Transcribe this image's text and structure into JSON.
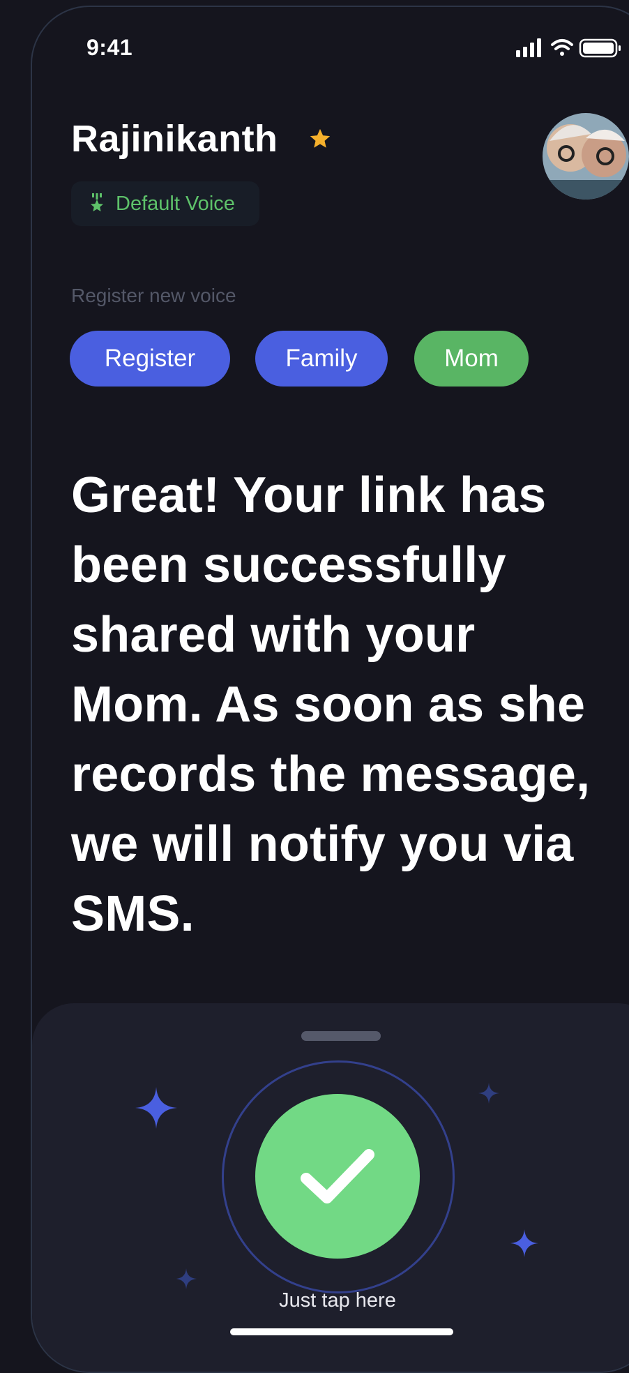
{
  "status_bar": {
    "time": "9:41"
  },
  "header": {
    "name": "Rajinikanth",
    "voice_badge": "Default Voice"
  },
  "register": {
    "caption": "Register new voice",
    "chips": [
      "Register",
      "Family",
      "Mom"
    ]
  },
  "message": "Great! Your link has been successfully shared with your Mom. As soon as she records the message, we will notify you via SMS.",
  "bottom_sheet": {
    "tap_label": "Just tap here"
  },
  "colors": {
    "background": "#15151e",
    "accent_blue": "#4a5fe0",
    "accent_green": "#59b564",
    "success_green": "#72d985",
    "star": "#f5b02c"
  },
  "icons": [
    "signal-icon",
    "wifi-icon",
    "battery-icon",
    "star-icon",
    "voice-icon",
    "check-icon",
    "sparkle-icon"
  ]
}
